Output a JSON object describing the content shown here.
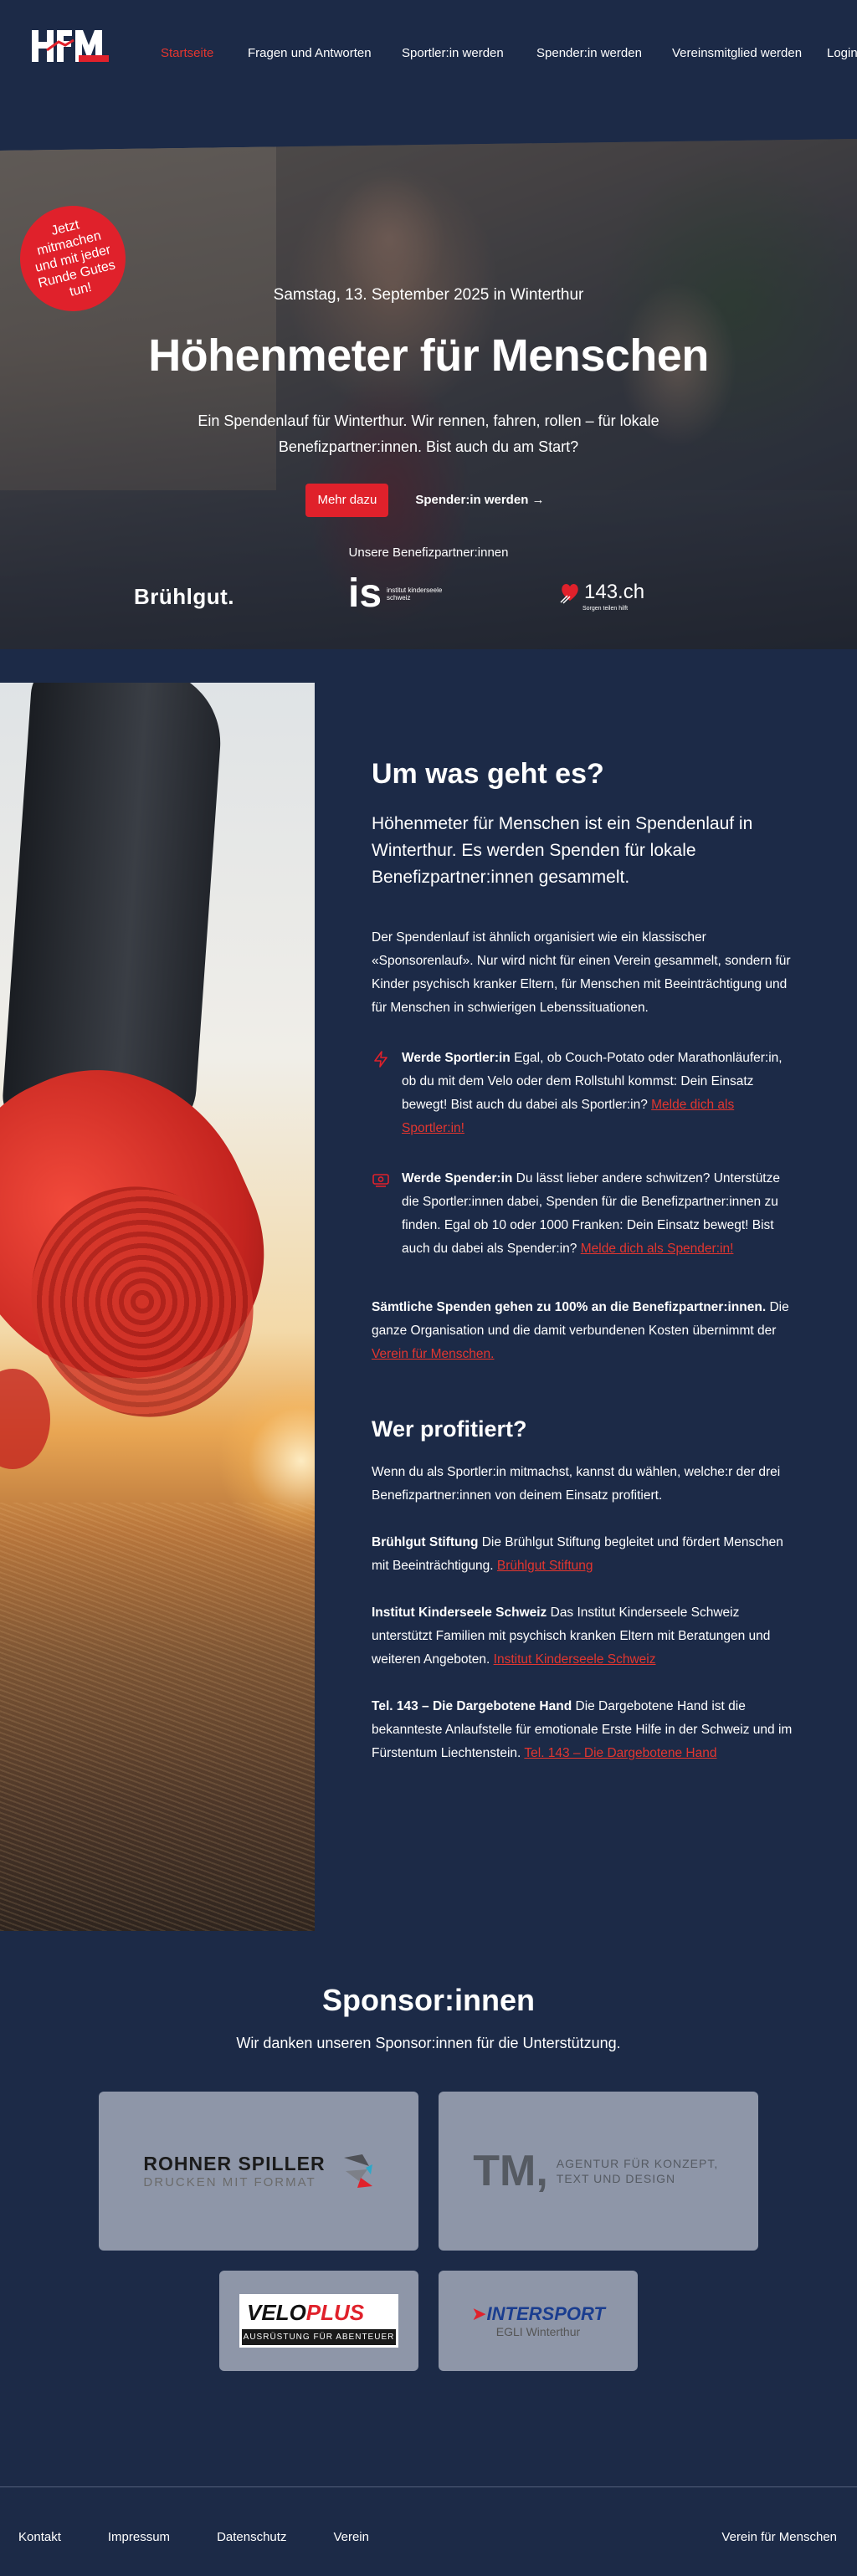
{
  "nav": {
    "logo_text": "HFM",
    "items": [
      {
        "label": "Startseite",
        "active": true
      },
      {
        "label": "Fragen und Antworten"
      },
      {
        "label": "Sportler:in werden"
      },
      {
        "label": "Spender:in werden"
      },
      {
        "label": "Vereinsmitglied werden"
      },
      {
        "label": "Login"
      }
    ]
  },
  "hero": {
    "badge": "Jetzt mitmachen und mit jeder Runde Gutes tun!",
    "date": "Samstag, 13. September 2025 in Winterthur",
    "title": "Höhenmeter für Menschen",
    "text": "Ein Spendenlauf für Winterthur. Wir rennen, fahren, rollen – für lokale Benefizpartner:innen. Bist auch du am Start?",
    "btn_primary": "Mehr dazu",
    "btn_secondary": "Spender:in werden →",
    "partners_label": "Unsere Benefizpartner:innen",
    "partner_bruehl": "Brühlgut.",
    "partner_is_big": "is",
    "partner_is_small": "institut kinderseele schweiz",
    "partner_143": "143.ch",
    "partner_143_sub": "Sorgen teilen hilft"
  },
  "about": {
    "title": "Um was geht es?",
    "lead": "Höhenmeter für Menschen ist ein Spendenlauf in Winterthur. Es werden Spenden für lokale Benefizpartner:innen gesammelt.",
    "intro": "Der Spendenlauf ist ähnlich organisiert wie ein klassischer «Sponsorenlauf». Nur wird nicht für einen Verein gesammelt, sondern für Kinder psychisch kranker Eltern, für Menschen mit Beeinträchtigung und für Menschen in schwierigen Lebenssituationen.",
    "f1_title": "Werde Sportler:in",
    "f1_text": " Egal, ob Couch-Potato oder Marathonläufer:in, ob du mit dem Velo oder dem Rollstuhl kommst: Dein Einsatz bewegt! Bist auch du dabei als Sportler:in? ",
    "f1_link": "Melde dich als Sportler:in!",
    "f2_title": "Werde Spender:in",
    "f2_text": " Du lässt lieber andere schwitzen? Unterstütze die Sportler:innen dabei, Spenden für die Benefizpartner:innen zu finden. Egal ob 10 oder 1000 Franken: Dein Einsatz bewegt! Bist auch du dabei als Spender:in? ",
    "f2_link": "Melde dich als Spender:in!",
    "note_bold": "Sämtliche Spenden gehen zu 100% an die Benefizpartner:innen.",
    "note_text": " Die ganze Organisation und die damit verbundenen Kosten übernimmt der ",
    "note_link": "Verein für Menschen.",
    "who_title": "Wer profitiert?",
    "who_intro": "Wenn du als Sportler:in mitmachst, kannst du wählen, welche:r der drei Benefizpartner:innen von deinem Einsatz profitiert.",
    "p1_name": "Brühlgut Stiftung",
    "p1_text": " Die Brühlgut Stiftung begleitet und fördert Menschen mit Beeinträchtigung. ",
    "p1_link": "Brühlgut Stiftung",
    "p2_name": "Institut Kinderseele Schweiz",
    "p2_text": " Das Institut Kinderseele Schweiz unterstützt Familien mit psychisch kranken Eltern mit Beratungen und weiteren Angeboten. ",
    "p2_link": "Institut Kinderseele Schweiz",
    "p3_name": "Tel. 143 – Die Dargebotene Hand",
    "p3_text": " Die Dargebotene Hand ist die bekannteste Anlaufstelle für emotionale Erste Hilfe in der Schweiz und im Fürstentum Liechtenstein. ",
    "p3_link": "Tel. 143 – Die Dargebotene Hand"
  },
  "sponsors": {
    "title": "Sponsor:innen",
    "subtitle": "Wir danken unseren Sponsor:innen für die Unterstützung.",
    "rohner_name": "ROHNER SPILLER",
    "rohner_tag": "DRUCKEN MIT FORMAT",
    "tm_big": "TM,",
    "tm_text": "AGENTUR FÜR KONZEPT, TEXT UND DESIGN",
    "velo_a": "VELO",
    "velo_b": "PLUS",
    "velo_sub": "AUSRÜSTUNG FÜR ABENTEUER",
    "intersport_name": "INTERSPORT",
    "intersport_sub": "EGLI Winterthur"
  },
  "footer": {
    "links": [
      "Kontakt",
      "Impressum",
      "Datenschutz",
      "Verein"
    ],
    "right": "Verein für Menschen"
  },
  "colors": {
    "background": "#1c2a47",
    "accent": "#e0212b",
    "card": "#8e96a8"
  }
}
